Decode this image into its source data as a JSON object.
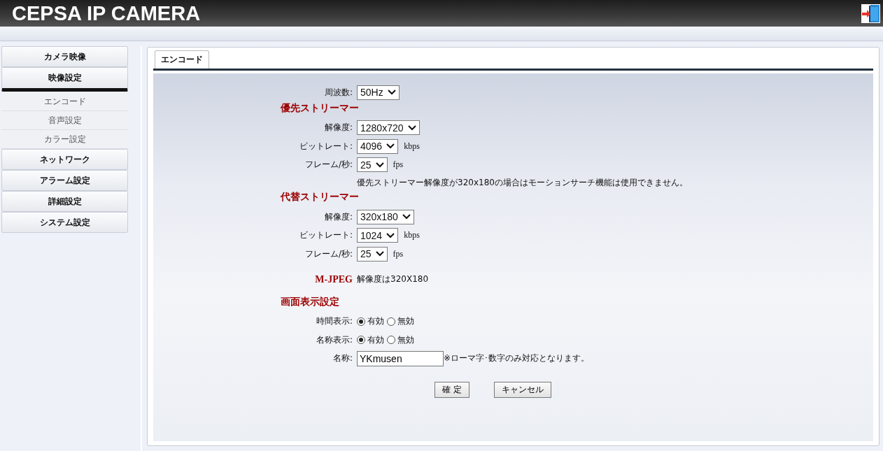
{
  "header": {
    "title": "CEPSA IP CAMERA"
  },
  "sidebar": {
    "items": [
      {
        "label": "カメラ映像",
        "expanded": false
      },
      {
        "label": "映像設定",
        "expanded": true,
        "children": [
          {
            "label": "エンコード"
          },
          {
            "label": "音声設定"
          },
          {
            "label": "カラー設定"
          }
        ]
      },
      {
        "label": "ネットワーク",
        "expanded": false
      },
      {
        "label": "アラーム設定",
        "expanded": false
      },
      {
        "label": "詳細設定",
        "expanded": false
      },
      {
        "label": "システム設定",
        "expanded": false
      }
    ]
  },
  "tabs": [
    {
      "label": "エンコード",
      "selected": true
    }
  ],
  "form": {
    "rows": [
      {
        "kind": "select",
        "label": "周波数:",
        "value": "50Hz"
      },
      {
        "kind": "heading",
        "label": "優先ストリーマー"
      },
      {
        "kind": "select",
        "label": "解像度:",
        "value": "1280x720"
      },
      {
        "kind": "select",
        "label": "ビットレート:",
        "value": "4096",
        "unit": "kbps"
      },
      {
        "kind": "select",
        "label": "フレーム/秒:",
        "value": "25",
        "unit": "fps"
      },
      {
        "kind": "note",
        "text": "優先ストリーマー解像度が320x180の場合はモーションサーチ機能は使用できません。"
      },
      {
        "kind": "heading",
        "label": "代替ストリーマー"
      },
      {
        "kind": "select",
        "label": "解像度:",
        "value": "320x180"
      },
      {
        "kind": "select",
        "label": "ビットレート:",
        "value": "1024",
        "unit": "kbps"
      },
      {
        "kind": "select",
        "label": "フレーム/秒:",
        "value": "25",
        "unit": "fps"
      },
      {
        "kind": "info",
        "label": "M-JPEG",
        "text": "解像度は320X180"
      },
      {
        "kind": "heading",
        "label": "画面表示設定"
      },
      {
        "kind": "radio",
        "label": "時間表示:",
        "options": [
          {
            "label": "有効",
            "selected": true
          },
          {
            "label": "無効",
            "selected": false
          }
        ]
      },
      {
        "kind": "radio",
        "label": "名称表示:",
        "options": [
          {
            "label": "有効",
            "selected": true
          },
          {
            "label": "無効",
            "selected": false
          }
        ]
      },
      {
        "kind": "text",
        "label": "名称:",
        "value": "YKmusen",
        "hint": "※ローマ字･数字のみ対応となります。"
      }
    ],
    "buttons": [
      "確 定",
      "キャンセル"
    ]
  }
}
